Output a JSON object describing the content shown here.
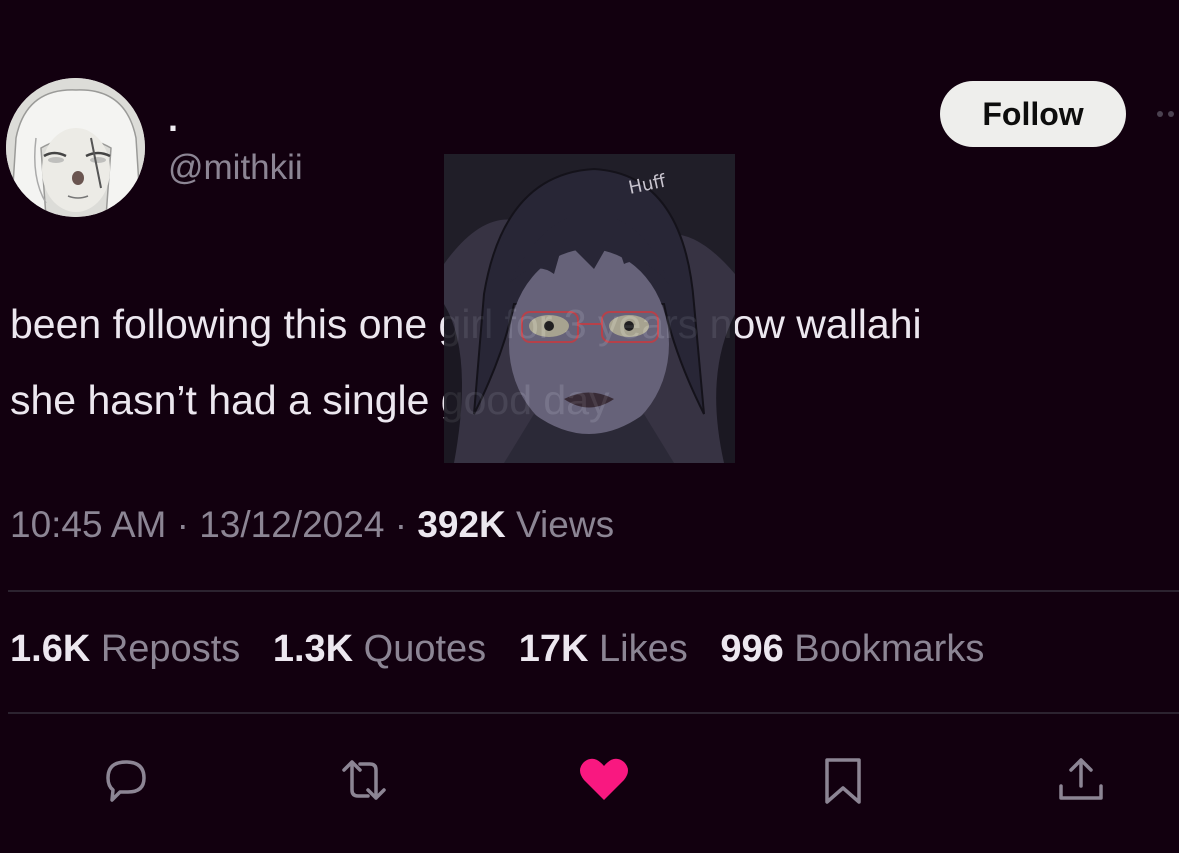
{
  "tweet": {
    "display_name": ".",
    "handle": "@mithkii",
    "follow_label": "Follow",
    "text_line1": "been following this one girl for 3 years now wallahi",
    "text_line2": "she hasn’t had a single good day",
    "overlay_caption": "Huff",
    "time": "10:45 AM",
    "sep": " · ",
    "date": "13/12/2024",
    "views_count": "392K",
    "views_label": " Views"
  },
  "stats": {
    "reposts": {
      "count": "1.6K",
      "label": "Reposts"
    },
    "quotes": {
      "count": "1.3K",
      "label": "Quotes"
    },
    "likes": {
      "count": "17K",
      "label": "Likes"
    },
    "bookmarks": {
      "count": "996",
      "label": "Bookmarks"
    }
  },
  "icons": {
    "reply": "reply-icon",
    "repost": "repost-icon",
    "like": "heart-icon",
    "bookmark": "bookmark-icon",
    "share": "share-icon",
    "more": "more-icon"
  },
  "colors": {
    "background": "#12000f",
    "like_active": "#f91880",
    "secondary_text": "#8c8594"
  }
}
